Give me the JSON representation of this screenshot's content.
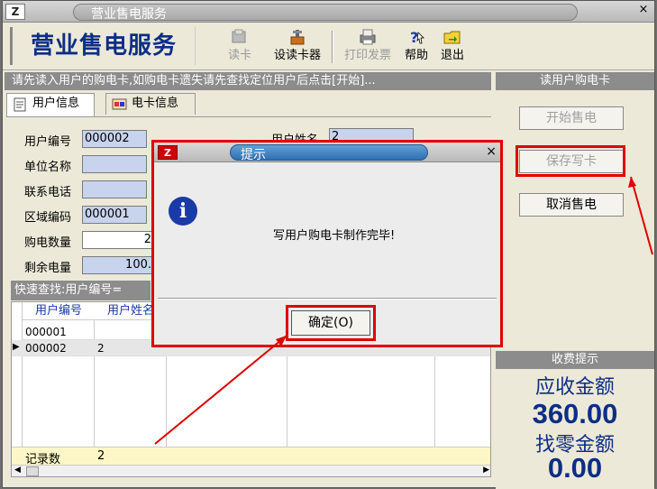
{
  "window": {
    "title": "营业售电服务",
    "logo": "Z"
  },
  "toolbar": {
    "app_title": "营业售电服务",
    "buttons": [
      {
        "label": "读卡",
        "icon": "card-reader-icon",
        "enabled": false
      },
      {
        "label": "设读卡器",
        "icon": "settings-tools-icon",
        "enabled": true
      },
      {
        "label": "打印发票",
        "icon": "printer-icon",
        "enabled": false
      },
      {
        "label": "帮助",
        "icon": "help-icon",
        "enabled": true
      },
      {
        "label": "退出",
        "icon": "exit-folder-icon",
        "enabled": true
      }
    ]
  },
  "hint": "请先读入用户的购电卡,如购电卡遗失请先查找定位用户后点击[开始]...",
  "tabs": [
    {
      "label": "用户信息",
      "active": true
    },
    {
      "label": "电卡信息",
      "active": false
    }
  ],
  "form": {
    "user_no_label": "用户编号",
    "user_no": "000002",
    "user_name_label": "用户姓名",
    "user_name": "2",
    "unit_label": "单位名称",
    "unit": "",
    "phone_label": "联系电话",
    "phone": "",
    "area_label": "区域编码",
    "area": "000001",
    "buy_label": "购电数量",
    "buy": "2",
    "remain_label": "剩余电量",
    "remain": "100."
  },
  "quick_search": "快速查找:用户编号=",
  "grid": {
    "columns": [
      "用户编号",
      "用户姓名"
    ],
    "rows": [
      [
        "000001",
        ""
      ],
      [
        "000002",
        "2"
      ]
    ],
    "footer_label": "记录数",
    "footer_value": "2"
  },
  "right_panel": {
    "header": "读用户购电卡",
    "start_btn": "开始售电",
    "save_btn": "保存写卡",
    "cancel_btn": "取消售电"
  },
  "fee": {
    "header": "收费提示",
    "receivable_label": "应收金额",
    "receivable": "360.00",
    "change_label": "找零金额",
    "change": "0.00"
  },
  "dialog": {
    "title": "提示",
    "message": "写用户购电卡制作完毕!",
    "ok_label": "确定(O)",
    "close": "×"
  },
  "colors": {
    "highlight": "#e00000",
    "accent": "#0c2e86"
  }
}
